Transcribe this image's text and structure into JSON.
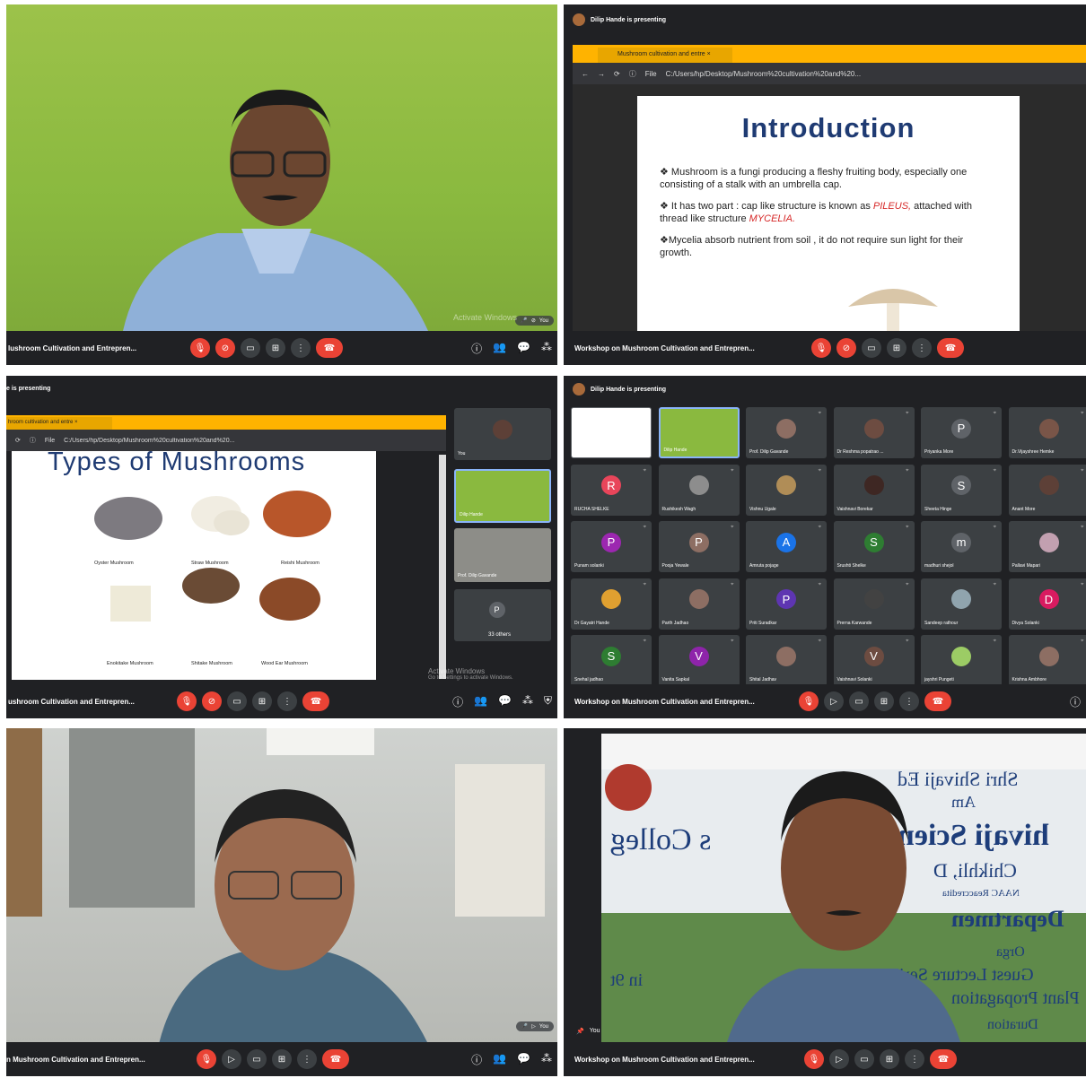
{
  "meeting_title_full": "Workshop on Mushroom Cultivation and Entrepren...",
  "meeting_title_crop1": "lushroom Cultivation and Entrepren...",
  "meeting_title_crop3": "ushroom Cultivation and Entrepren...",
  "meeting_title_crop5": "n Mushroom Cultivation and Entrepren...",
  "you_label": "You",
  "activate_windows": "Activate Windows",
  "activate_windows_sub": "Go to Settings to activate Windows.",
  "participants_badge": "39",
  "presenting_text": "Dilip Hande is presenting",
  "presenting_crop": "e is presenting",
  "browser": {
    "tab_title": "Mushroom cultivation and entre",
    "tab_title_crop": "hroom cultivation and entre",
    "file_label": "File",
    "url": "C:/Users/hp/Desktop/Mushroom%20cultivation%20and%20..."
  },
  "slide_intro": {
    "title": "Introduction",
    "b1": "Mushroom is a fungi producing a fleshy fruiting body, especially one consisting of a stalk with an umbrella cap.",
    "b2_a": "It has two part : cap like structure is known as ",
    "b2_pileus": "PILEUS,",
    "b2_b": "attached with thread like structure ",
    "b2_mycelia": "MYCELIA.",
    "b3": "Mycelia absorb nutrient from soil , it do not require sun light for their growth."
  },
  "slide_types": {
    "title": "Types of Mushrooms",
    "items": [
      "Oyster Mushroom",
      "Straw Mushroom",
      "Reishi Mushroom",
      "Enokitake Mushroom",
      "Shitake Mushroom",
      "Wood Ear Mushroom"
    ]
  },
  "side_tiles": {
    "you": "You",
    "dilip": "Dilip Hande",
    "gavande": "Prof. Dilip Gavande",
    "others": "33 others",
    "others_letter": "P"
  },
  "grid": [
    {
      "name": "",
      "letter": "",
      "color": "",
      "kind": "screen"
    },
    {
      "name": "Dilip Hande",
      "letter": "",
      "color": "",
      "kind": "video"
    },
    {
      "name": "Prof. Dilip Gavande",
      "letter": "",
      "color": "#8d6e63",
      "kind": "photo"
    },
    {
      "name": "Dr Reshma popatrao ...",
      "letter": "",
      "color": "#6d4c41",
      "kind": "photo"
    },
    {
      "name": "Priyanka More",
      "letter": "P",
      "color": "#5f6368",
      "kind": "letter"
    },
    {
      "name": "Dr.Vijayshree Hemke",
      "letter": "",
      "color": "#795548",
      "kind": "photo"
    },
    {
      "name": "RUCHA SHELKE",
      "letter": "R",
      "color": "#e8455a",
      "kind": "letter"
    },
    {
      "name": "Rushikesh Wagh",
      "letter": "",
      "color": "#8d8d8d",
      "kind": "photo"
    },
    {
      "name": "Vishnu Ugale",
      "letter": "",
      "color": "#b08d57",
      "kind": "photo"
    },
    {
      "name": "Vaishnavi Borekar",
      "letter": "",
      "color": "#3e2723",
      "kind": "photo"
    },
    {
      "name": "Sheeta Hinge",
      "letter": "S",
      "color": "#5f6368",
      "kind": "letter"
    },
    {
      "name": "Anant More",
      "letter": "",
      "color": "#5d4037",
      "kind": "photo"
    },
    {
      "name": "Punam solanki",
      "letter": "P",
      "color": "#9c27b0",
      "kind": "letter"
    },
    {
      "name": "Pooja Yewale",
      "letter": "P",
      "color": "#8d6e63",
      "kind": "letter"
    },
    {
      "name": "Amruta pojage",
      "letter": "A",
      "color": "#1a73e8",
      "kind": "letter"
    },
    {
      "name": "Srushti Shelke",
      "letter": "S",
      "color": "#2e7d32",
      "kind": "letter"
    },
    {
      "name": "madhuri shejol",
      "letter": "m",
      "color": "#5f6368",
      "kind": "letter"
    },
    {
      "name": "Pallavi Mapari",
      "letter": "",
      "color": "#c2a0b0",
      "kind": "photo"
    },
    {
      "name": "Dr Gayatri Hande",
      "letter": "",
      "color": "#e0a030",
      "kind": "photo"
    },
    {
      "name": "Parth Jadhao",
      "letter": "",
      "color": "#8d6e63",
      "kind": "photo"
    },
    {
      "name": "Priti Suradkar",
      "letter": "P",
      "color": "#5e35b1",
      "kind": "letter"
    },
    {
      "name": "Prerna Karwande",
      "letter": "",
      "color": "#424242",
      "kind": "photo"
    },
    {
      "name": "Sandeep rathour",
      "letter": "",
      "color": "#90a4ae",
      "kind": "photo"
    },
    {
      "name": "Divya Solanki",
      "letter": "D",
      "color": "#d81b60",
      "kind": "letter"
    },
    {
      "name": "Snehal jadhao",
      "letter": "S",
      "color": "#2e7d32",
      "kind": "letter"
    },
    {
      "name": "Vanita Sapkal",
      "letter": "V",
      "color": "#8e24aa",
      "kind": "letter"
    },
    {
      "name": "Shital Jadhav",
      "letter": "",
      "color": "#8d6e63",
      "kind": "photo"
    },
    {
      "name": "Vaishnavi Solanki",
      "letter": "V",
      "color": "#6d4c41",
      "kind": "letter"
    },
    {
      "name": "jayshri Pungeti",
      "letter": "",
      "color": "#9ccc65",
      "kind": "photo"
    },
    {
      "name": "Krishna Ambhore",
      "letter": "",
      "color": "#8d6e63",
      "kind": "photo"
    }
  ],
  "banner_lines": [
    "Shri Shivaji Ed",
    "Am",
    "hivaji Scien",
    "s Colleg",
    "Chikhli, D",
    "NAAC Reaccredita",
    "Departmen",
    "Orga",
    "in 9t",
    "Guest Lecture Series o",
    "Plant Propagation",
    "Duration"
  ]
}
